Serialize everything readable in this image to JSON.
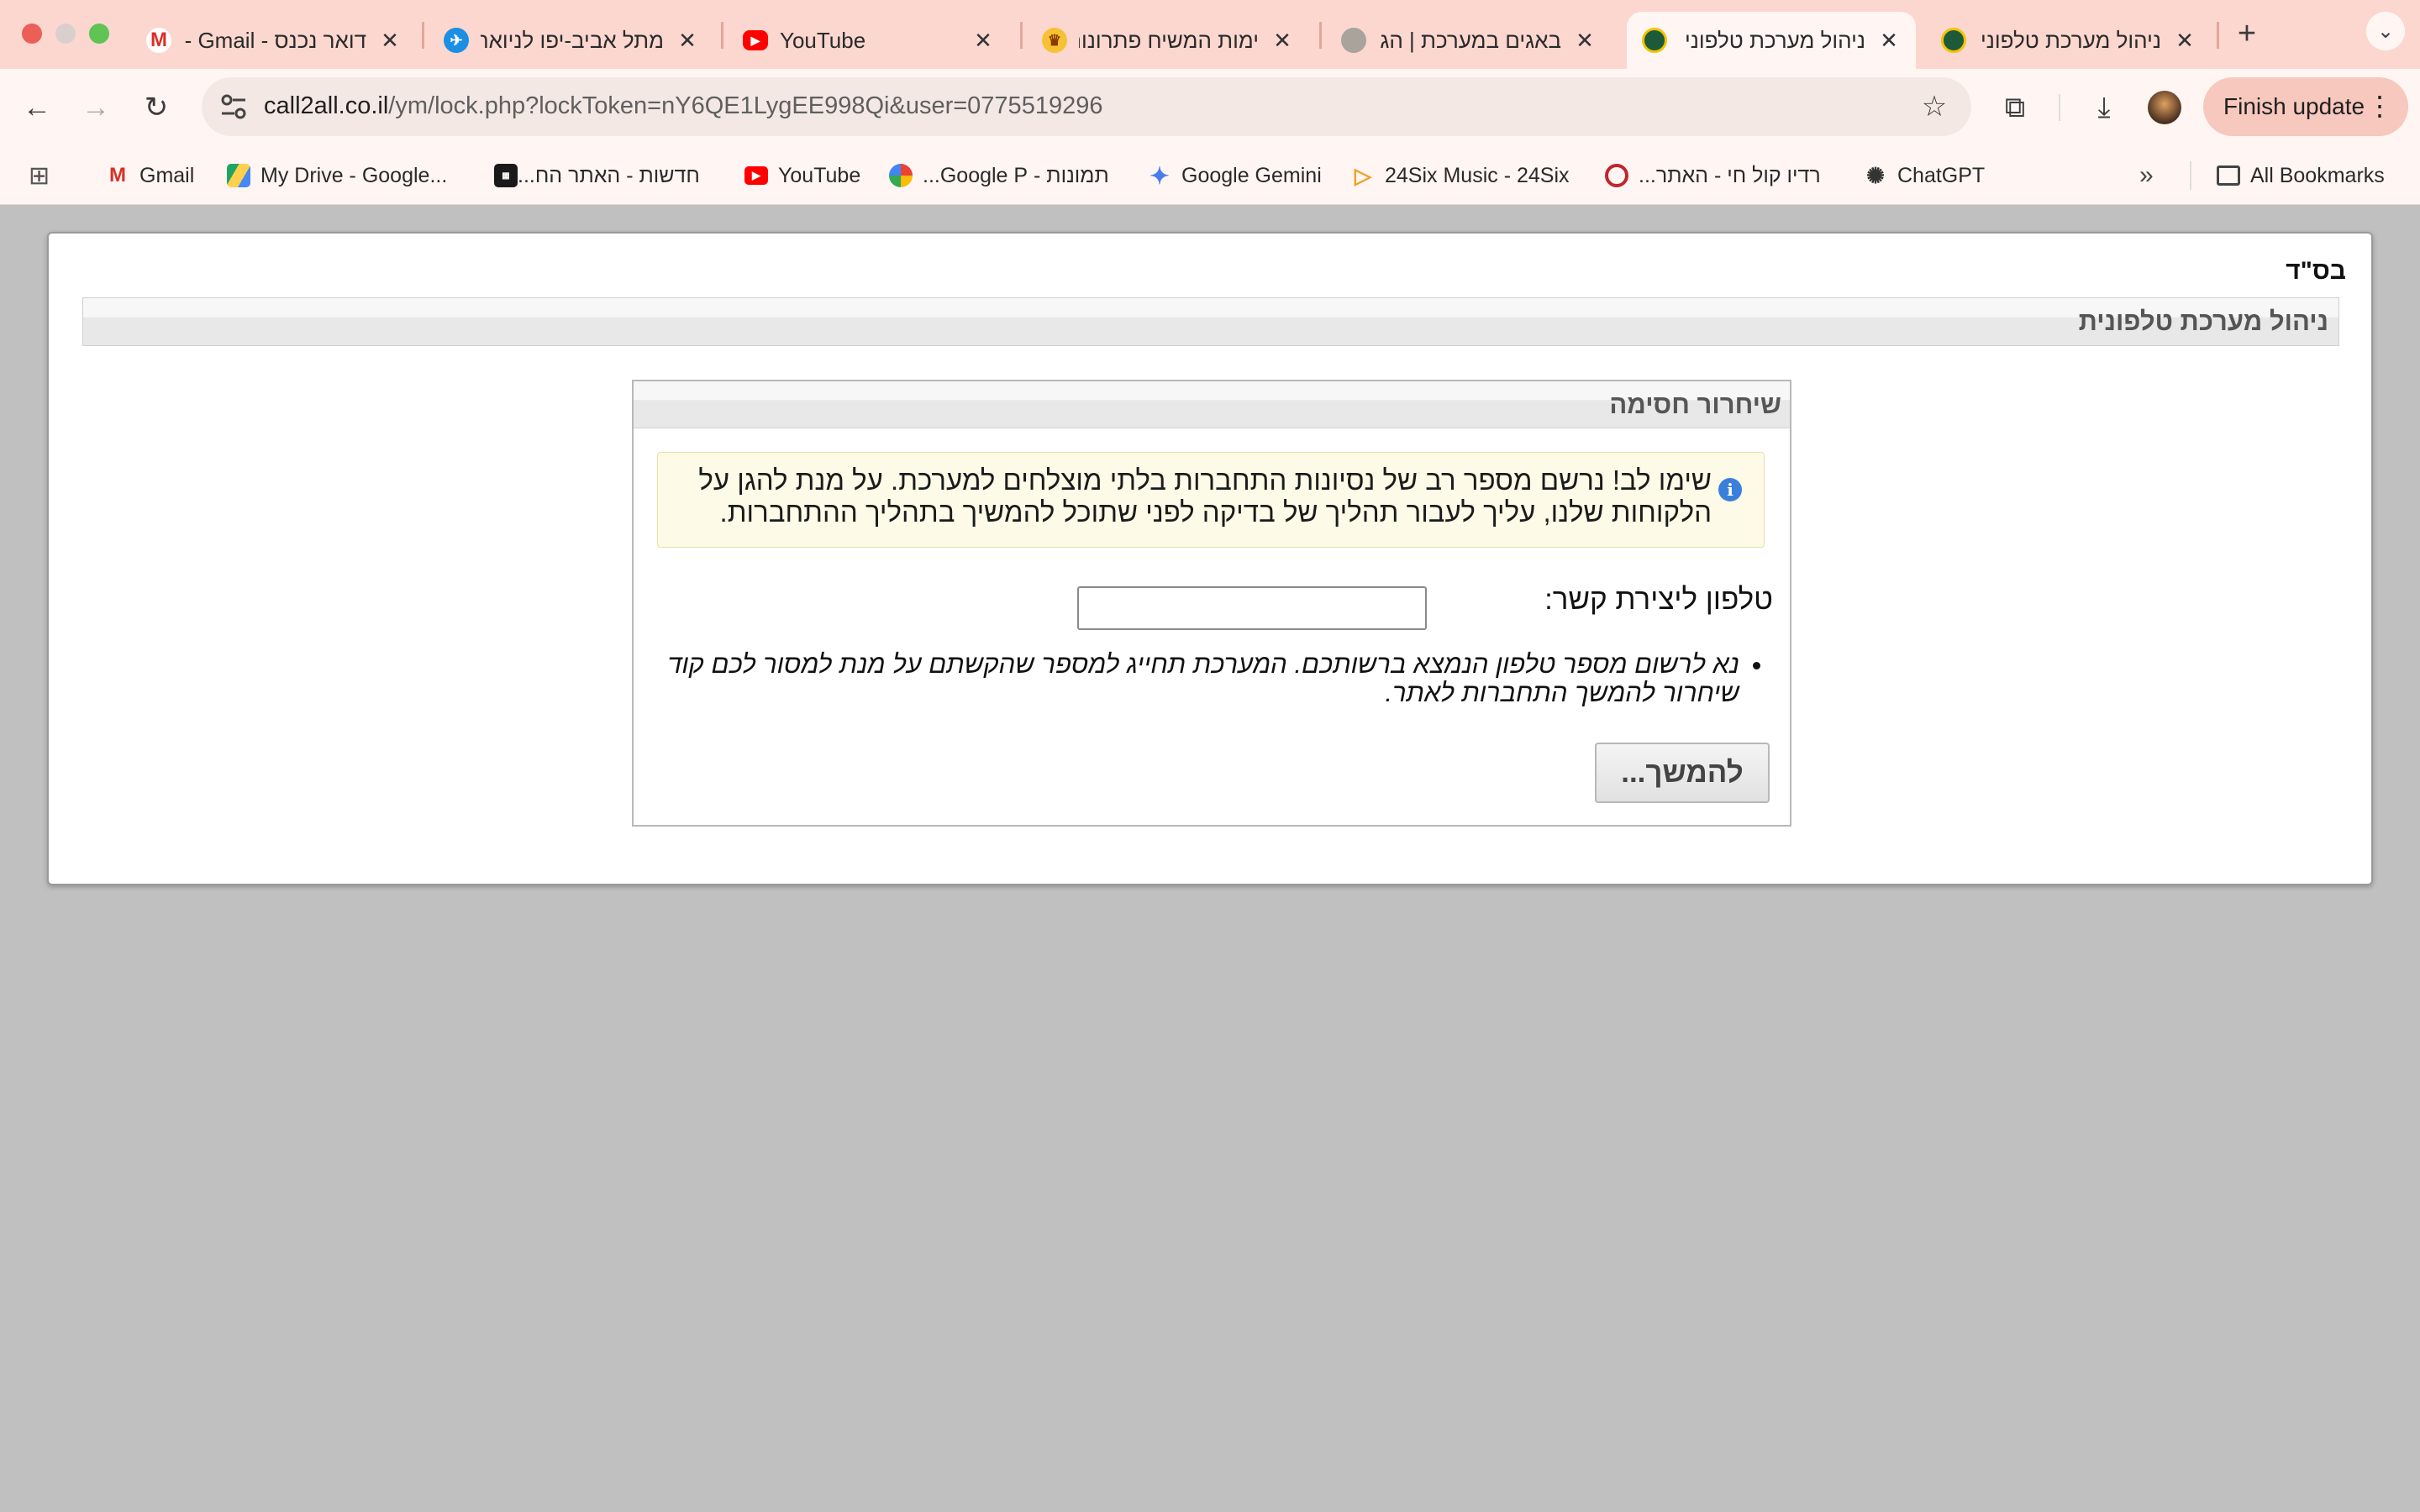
{
  "browser": {
    "tabs": [
      {
        "title": "דואר נכנס - Gmail -",
        "icon": "gmail-icon",
        "active": false
      },
      {
        "title": "מתל אביב-יפו לניואר",
        "icon": "airplane-icon",
        "active": false
      },
      {
        "title": "YouTube",
        "icon": "youtube-icon",
        "active": false
      },
      {
        "title": "ימות המשיח פתרונות",
        "icon": "crown-icon",
        "active": false
      },
      {
        "title": "באגים במערכת | הג",
        "icon": "site-icon",
        "active": false
      },
      {
        "title": "ניהול מערכת טלפוני",
        "icon": "call2all-icon",
        "active": true
      },
      {
        "title": "ניהול מערכת טלפוני",
        "icon": "call2all-icon",
        "active": false
      }
    ],
    "url_host": "call2all.co.il",
    "url_rest": "/ym/lock.php?lockToken=nY6QE1LygEE998Qi&user=0775519296",
    "finish_update": "Finish update",
    "bookmarks": [
      {
        "label": "Gmail",
        "icon": "gmail-icon"
      },
      {
        "label": "My Drive - Google...",
        "icon": "google-drive-icon"
      },
      {
        "label": "חדשות - האתר הח...",
        "icon": "news-icon"
      },
      {
        "label": "YouTube",
        "icon": "youtube-icon"
      },
      {
        "label": "תמונות - Google P...",
        "icon": "google-photos-icon"
      },
      {
        "label": "Google Gemini",
        "icon": "gemini-icon"
      },
      {
        "label": "24Six Music - 24Six",
        "icon": "24six-icon"
      },
      {
        "label": "רדיו קול חי - האתר...",
        "icon": "radio-icon"
      },
      {
        "label": "ChatGPT",
        "icon": "chatgpt-icon"
      }
    ],
    "all_bookmarks": "All Bookmarks"
  },
  "page": {
    "bsd": "בס\"ד",
    "title": "ניהול מערכת טלפונית",
    "panel_title": "שיחרור חסימה",
    "warning": "שימו לב! נרשם מספר רב של נסיונות התחברות בלתי מוצלחים למערכת. על מנת להגן על הלקוחות שלנו, עליך לעבור תהליך של בדיקה לפני שתוכל להמשיך בתהליך ההתחברות.",
    "phone_label": "טלפון ליצירת קשר:",
    "phone_value": "",
    "note": "נא לרשום מספר טלפון הנמצא ברשותכם. המערכת תחייג למספר שהקשתם על מנת למסור לכם קוד שיחרור להמשך התחברות לאתר.",
    "continue_label": "להמשך..."
  },
  "colors": {
    "tabstrip": "#fbd7cf",
    "toolbar": "#fff6f4",
    "page_bg": "#c0c0c0",
    "warning_bg": "#fdfbe7",
    "info_blue": "#3a7fdc"
  }
}
